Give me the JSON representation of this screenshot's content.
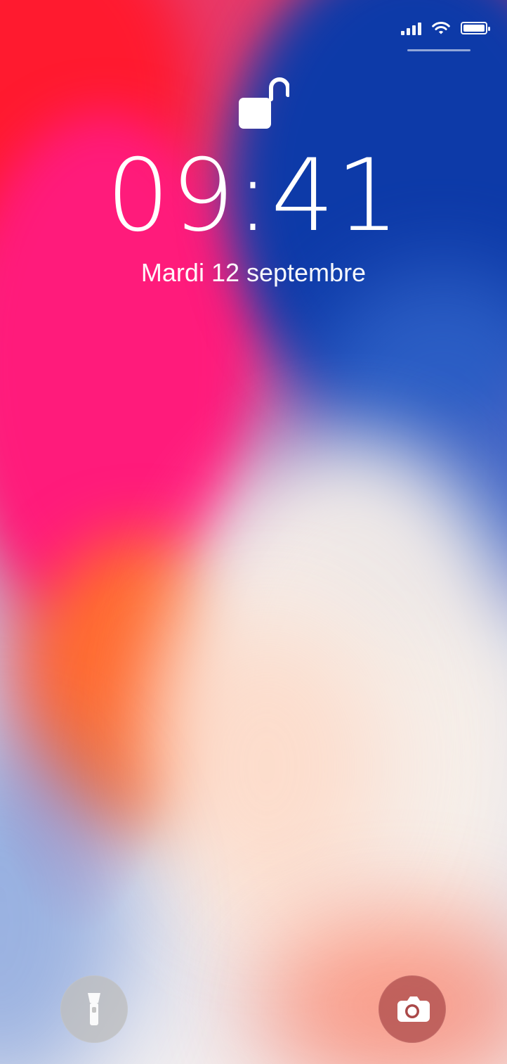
{
  "status_bar": {
    "signal_bars": 4,
    "wifi": true,
    "battery_level": 1.0
  },
  "lock_screen": {
    "lock_state": "unlocked",
    "time": "09:41",
    "date": "Mardi 12 septembre"
  },
  "quick_actions": {
    "left": {
      "icon": "flashlight-icon"
    },
    "right": {
      "icon": "camera-icon"
    }
  },
  "colors": {
    "text": "#ffffff",
    "wallpaper_red": "#ff1a2f",
    "wallpaper_magenta": "#ff1b7b",
    "wallpaper_blue": "#0d3aa8",
    "wallpaper_white": "#f7efe9",
    "flashlight_button": "#bebebe",
    "camera_button": "#aa4848"
  }
}
